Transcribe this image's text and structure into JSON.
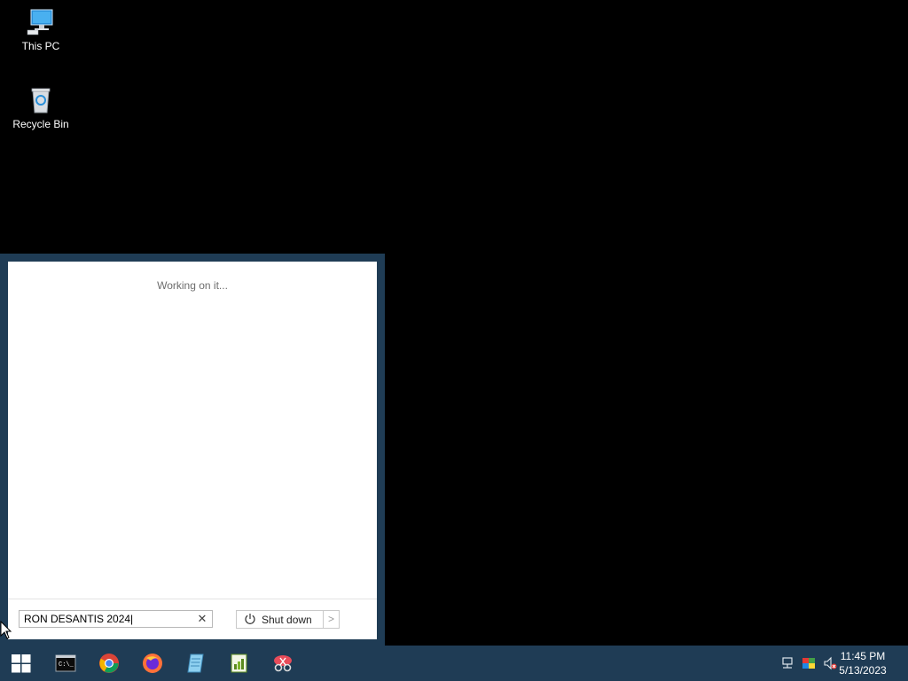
{
  "desktop": {
    "icons": [
      {
        "label": "This PC"
      },
      {
        "label": "Recycle Bin"
      }
    ]
  },
  "start_menu": {
    "status_text": "Working on it...",
    "search": {
      "value": "RON DESANTIS 2024|"
    },
    "shutdown_label": "Shut down"
  },
  "taskbar": {
    "pinned": [
      "start-icon",
      "command-prompt-icon",
      "chrome-icon",
      "firefox-icon",
      "notepad-icon",
      "spreadsheet-icon",
      "snipping-tool-icon"
    ],
    "clock": {
      "time": "11:45 PM",
      "date": "5/13/2023"
    }
  },
  "colors": {
    "taskbar": "#1f3c55",
    "desktop": "#000000"
  }
}
